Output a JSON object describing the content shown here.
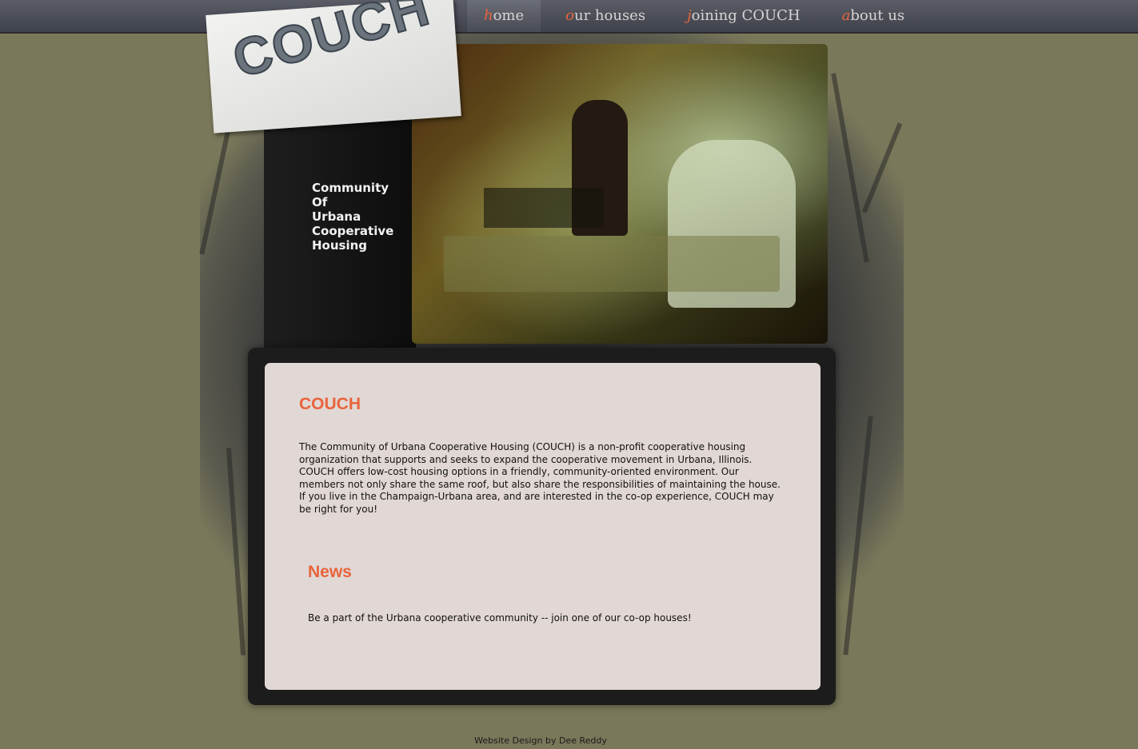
{
  "nav": {
    "items": [
      {
        "first": "h",
        "rest": "ome"
      },
      {
        "first": "o",
        "rest": "ur houses"
      },
      {
        "first": "j",
        "rest": "oining COUCH"
      },
      {
        "first": "a",
        "rest": "bout us"
      }
    ],
    "active_index": 0
  },
  "logo": {
    "text": "COUCH"
  },
  "tagline": [
    "Community",
    "Of",
    "Urbana",
    "Cooperative",
    "Housing"
  ],
  "main": {
    "title": "COUCH",
    "body": "The Community of Urbana Cooperative Housing (COUCH) is a non-profit cooperative housing organization that supports and seeks to expand the cooperative movement in Urbana, Illinois. COUCH offers low-cost housing options in a friendly, community-oriented environment. Our members not only share the same roof, but also share the responsibilities of maintaining the house. If you live in the Champaign-Urbana area, and are interested in the co-op experience, COUCH may be right for you!"
  },
  "news": {
    "title": "News",
    "body": "Be a part of the Urbana cooperative community -- join one of our co-op houses!"
  },
  "footer": {
    "text": "Website Design by Dee Reddy"
  },
  "colors": {
    "accent": "#e8643c",
    "background": "#7a785a",
    "panel": "#e1d7d4"
  }
}
